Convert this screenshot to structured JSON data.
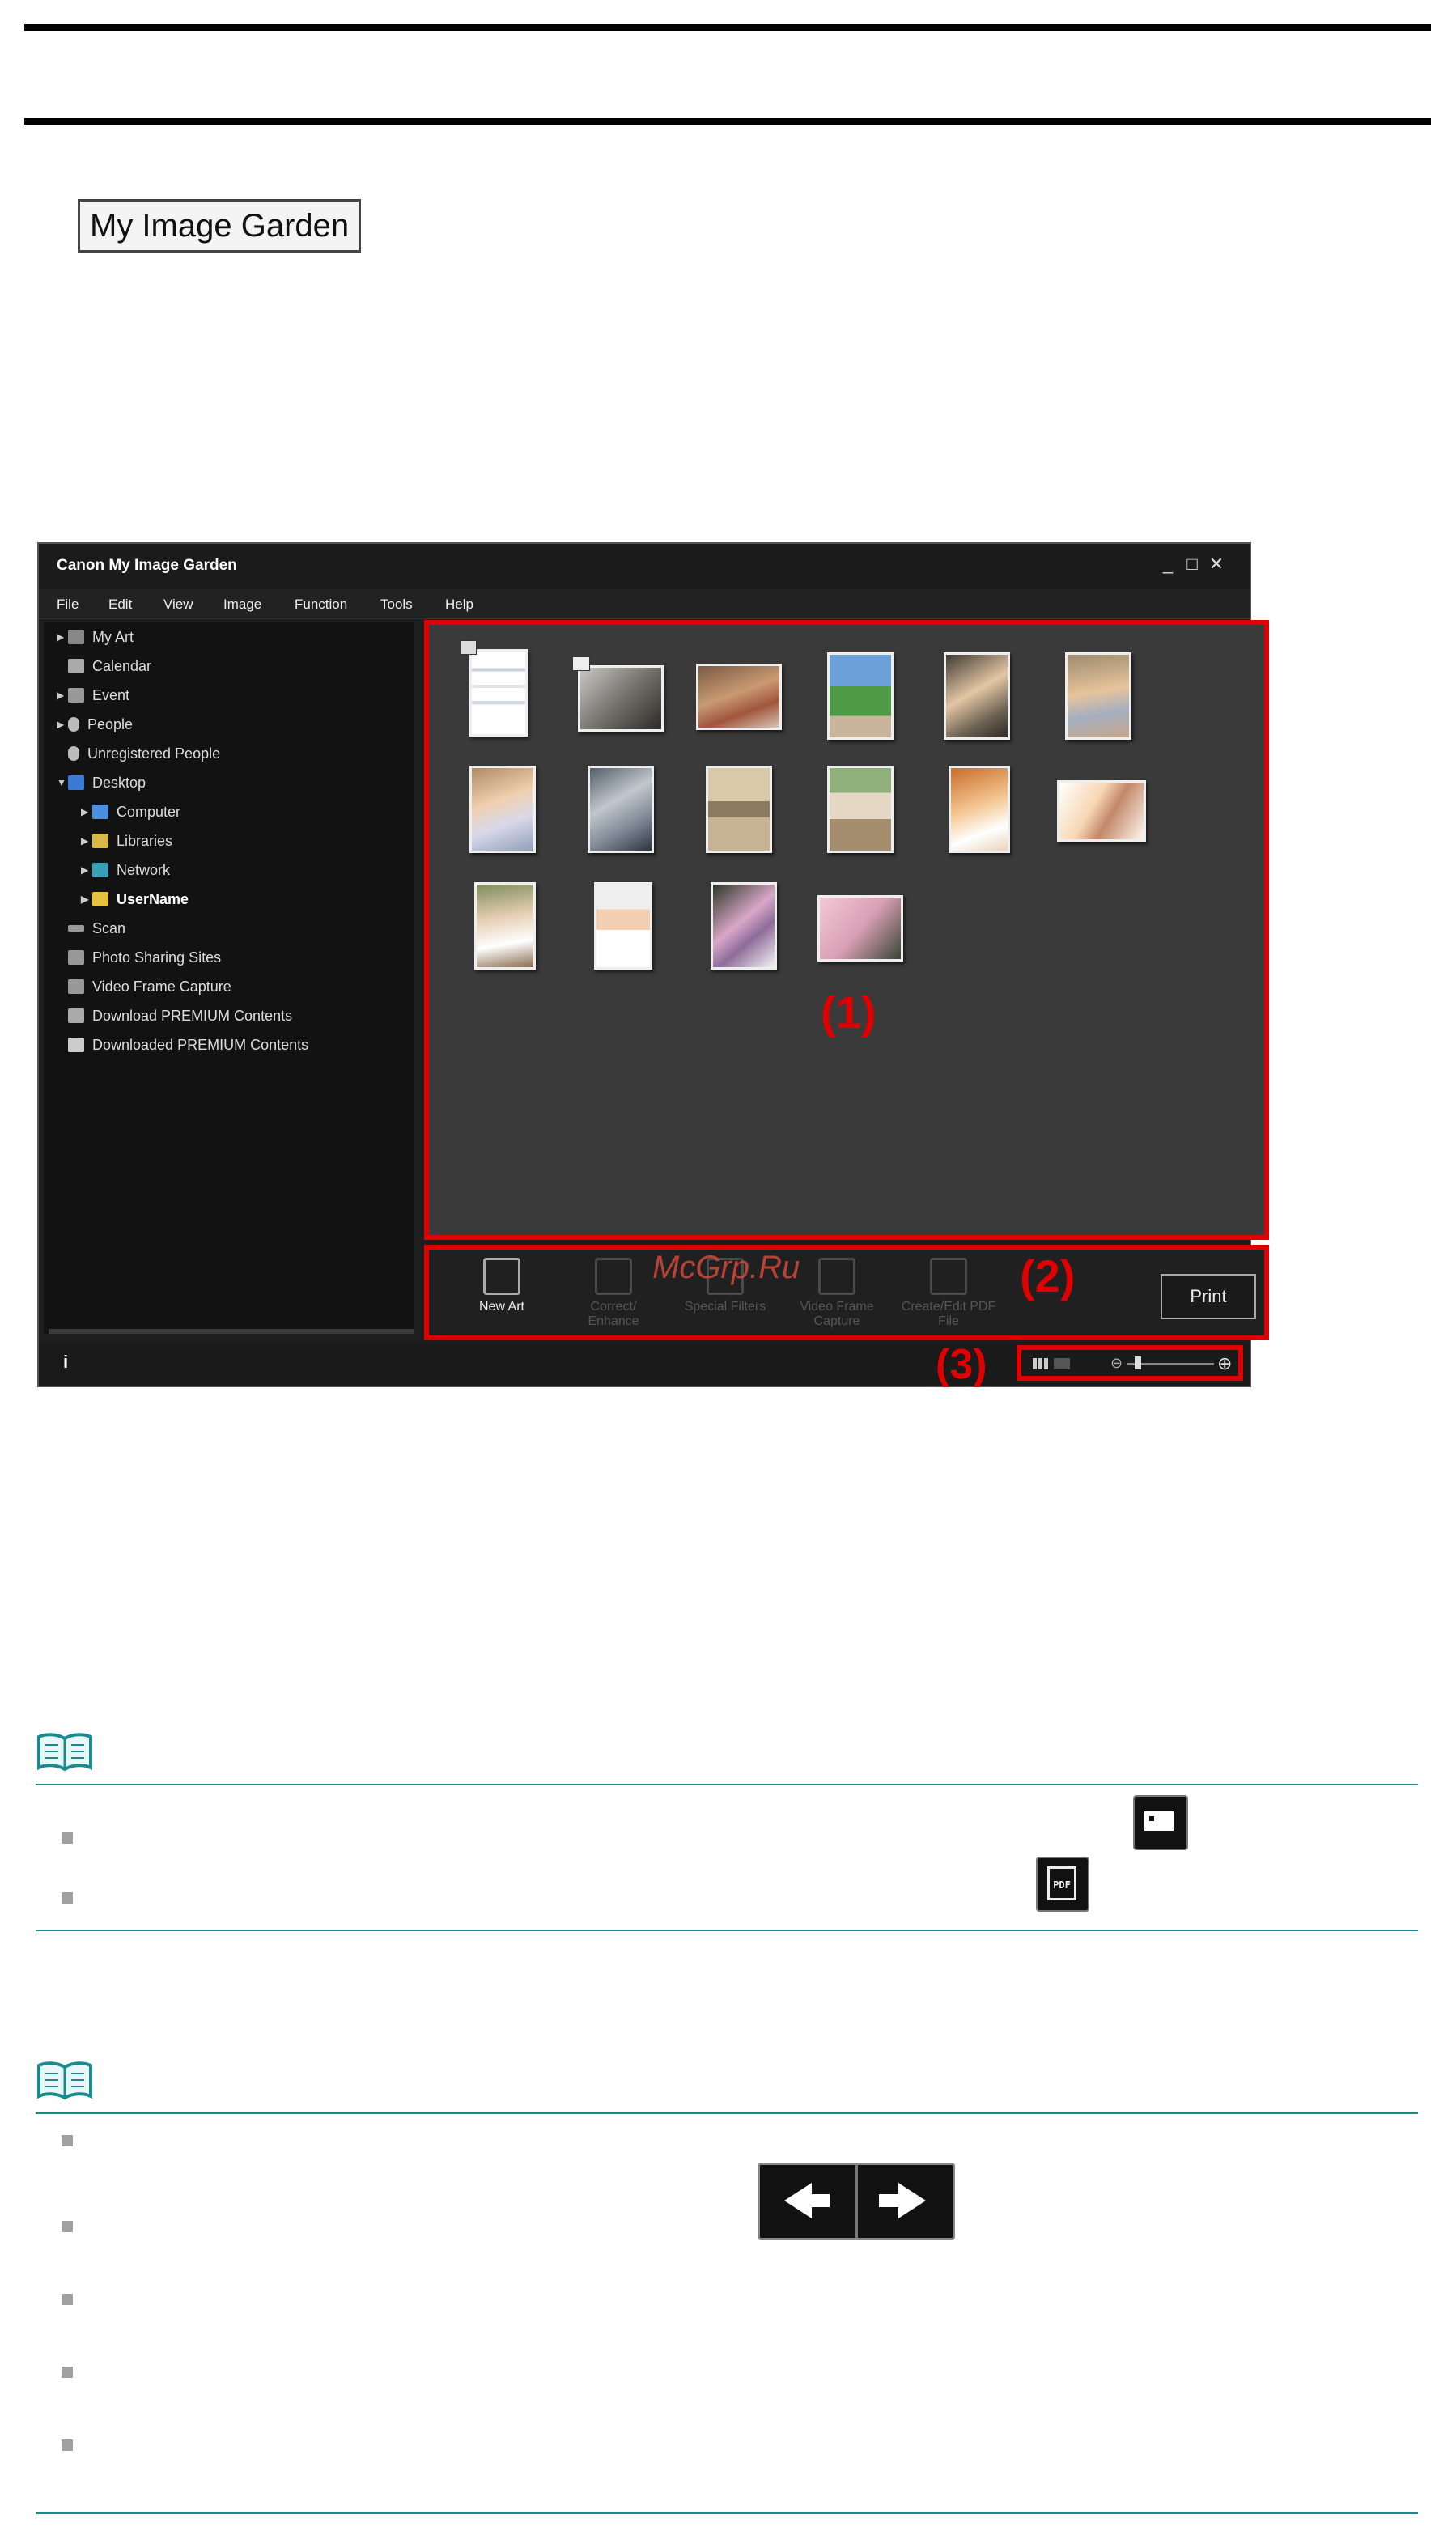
{
  "badge_label": "My Image Garden",
  "window": {
    "title": "Canon My Image Garden",
    "controls": {
      "minimize": "_",
      "maximize": "□",
      "close": "✕"
    }
  },
  "menubar": [
    "File",
    "Edit",
    "View",
    "Image",
    "Function",
    "Tools",
    "Help"
  ],
  "sidebar": [
    {
      "label": "My Art",
      "icon": "my-art-icon",
      "expander": true
    },
    {
      "label": "Calendar",
      "icon": "calendar-icon",
      "expander": false
    },
    {
      "label": "Event",
      "icon": "event-icon",
      "expander": true
    },
    {
      "label": "People",
      "icon": "people-icon",
      "expander": true
    },
    {
      "label": "Unregistered People",
      "icon": "unregistered-people-icon",
      "expander": false
    },
    {
      "label": "Desktop",
      "icon": "desktop-icon",
      "expander": true,
      "expanded": true
    },
    {
      "label": "Computer",
      "icon": "computer-icon",
      "expander": true,
      "child": true
    },
    {
      "label": "Libraries",
      "icon": "libraries-icon",
      "expander": true,
      "child": true
    },
    {
      "label": "Network",
      "icon": "network-icon",
      "expander": true,
      "child": true
    },
    {
      "label": "UserName",
      "icon": "folder-icon",
      "expander": true,
      "child": true,
      "selected": true
    },
    {
      "label": "Scan",
      "icon": "scan-icon",
      "expander": false
    },
    {
      "label": "Photo Sharing Sites",
      "icon": "photo-sharing-icon",
      "expander": false
    },
    {
      "label": "Video Frame Capture",
      "icon": "video-frame-icon",
      "expander": false
    },
    {
      "label": "Download PREMIUM Contents",
      "icon": "download-icon",
      "expander": false
    },
    {
      "label": "Downloaded PREMIUM Contents",
      "icon": "downloaded-folder-icon",
      "expander": false
    }
  ],
  "annotations": {
    "area1": "(1)",
    "area2": "(2)",
    "area3": "(3)"
  },
  "toolbar": {
    "tools": [
      {
        "label": "New Art",
        "enabled": true
      },
      {
        "label": "Correct/ Enhance",
        "enabled": false
      },
      {
        "label": "Special Filters",
        "enabled": false
      },
      {
        "label": "Video Frame Capture",
        "enabled": false
      },
      {
        "label": "Create/Edit PDF File",
        "enabled": false
      }
    ],
    "print_label": "Print"
  },
  "statusbar": {
    "info": "i",
    "zoom_level_fraction": 0.1
  },
  "watermark": "McGrp.Ru",
  "colors": {
    "annotation_red": "#e00000",
    "note_line": "#1a8a8e",
    "app_bg": "#1e1e1e",
    "content_bg": "#3a3a3a"
  }
}
